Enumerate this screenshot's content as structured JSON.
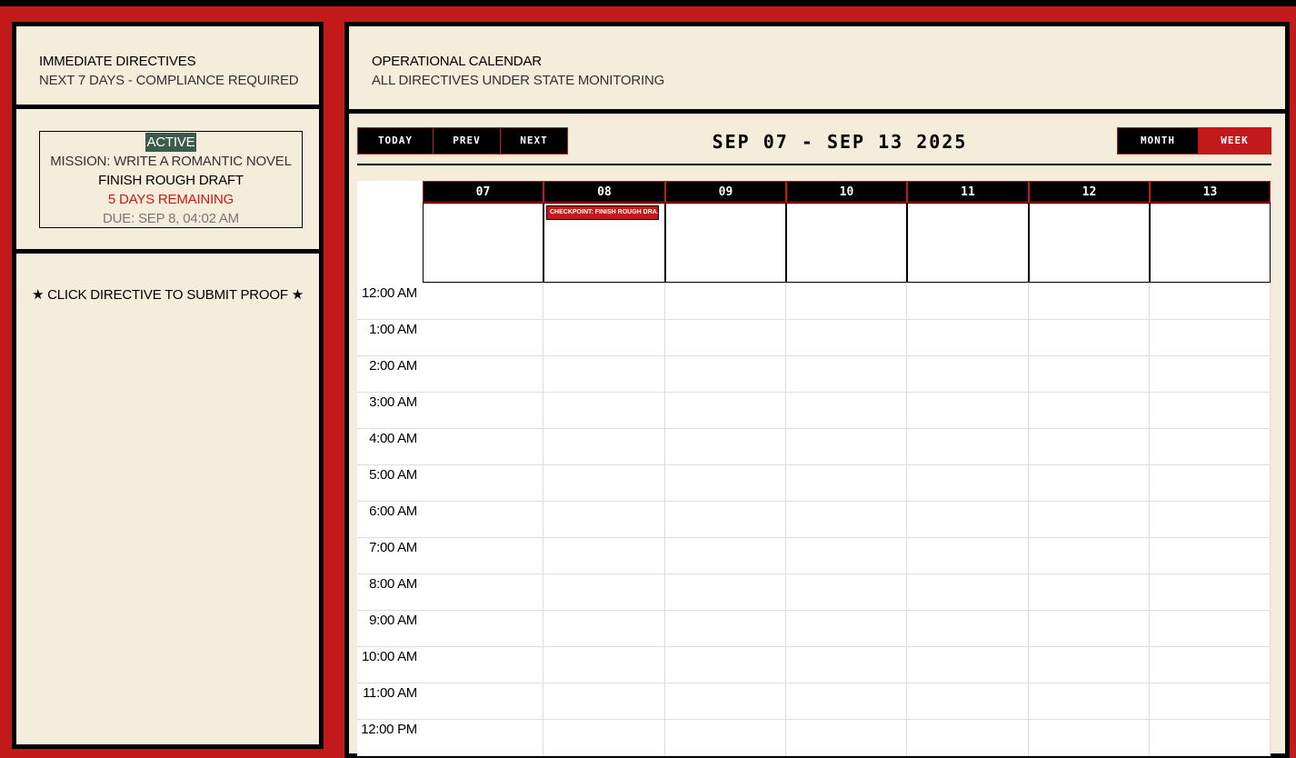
{
  "left": {
    "header": {
      "title": "IMMEDIATE DIRECTIVES",
      "subtitle": "NEXT 7 DAYS - COMPLIANCE REQUIRED"
    },
    "directive": {
      "status": "ACTIVE",
      "mission": "MISSION: WRITE A ROMANTIC NOVEL",
      "task": "FINISH ROUGH DRAFT",
      "remaining": "5 DAYS REMAINING",
      "due": "DUE: SEP 8, 04:02 AM"
    },
    "hint": "★ CLICK DIRECTIVE TO SUBMIT PROOF ★"
  },
  "calendar": {
    "header": {
      "title": "OPERATIONAL CALENDAR",
      "subtitle": "ALL DIRECTIVES UNDER STATE MONITORING"
    },
    "toolbar": {
      "today": "TODAY",
      "prev": "PREV",
      "next": "NEXT",
      "month": "MONTH",
      "week": "WEEK",
      "active_view": "week"
    },
    "range": "SEP 07 - SEP 13 2025",
    "days": [
      "07",
      "08",
      "09",
      "10",
      "11",
      "12",
      "13"
    ],
    "event": {
      "day": "08",
      "label": "CHECKPOINT: FINISH ROUGH DRA..."
    },
    "hours": [
      "12:00 AM",
      "1:00 AM",
      "2:00 AM",
      "3:00 AM",
      "4:00 AM",
      "5:00 AM",
      "6:00 AM",
      "7:00 AM",
      "8:00 AM",
      "9:00 AM",
      "10:00 AM",
      "11:00 AM",
      "12:00 PM"
    ]
  },
  "colors": {
    "accent": "#c21a1a",
    "panel": "#f5eddc",
    "badge": "#3d5b4a",
    "ink": "#000000"
  }
}
